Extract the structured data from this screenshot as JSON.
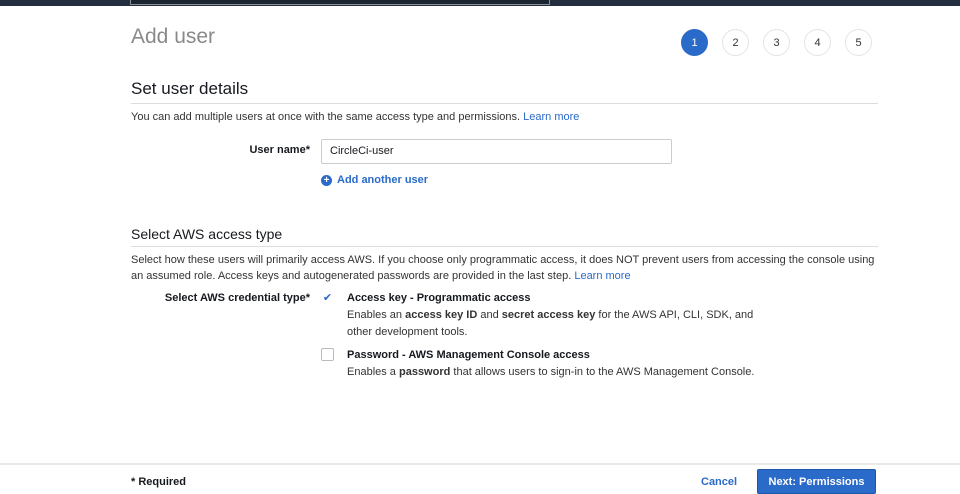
{
  "header": {
    "title": "Add user",
    "steps": [
      "1",
      "2",
      "3",
      "4",
      "5"
    ],
    "active_step": 1
  },
  "details": {
    "heading": "Set user details",
    "description": "You can add multiple users at once with the same access type and permissions.",
    "learn_more": "Learn more",
    "user_name_label": "User name*",
    "user_name_value": "CircleCi-user",
    "add_another": "Add another user"
  },
  "access": {
    "heading": "Select AWS access type",
    "description": "Select how these users will primarily access AWS. If you choose only programmatic access, it does NOT prevent users from accessing the console using an assumed role. Access keys and autogenerated passwords are provided in the last step.",
    "learn_more": "Learn more",
    "credential_label": "Select AWS credential type*",
    "options": [
      {
        "title": "Access key - Programmatic access",
        "checked": true,
        "d1": "Enables an ",
        "b1": "access key ID",
        "d2": " and ",
        "b2": "secret access key",
        "d3": " for the AWS API, CLI, SDK, and other development tools."
      },
      {
        "title": "Password - AWS Management Console access",
        "checked": false,
        "d1": "Enables a ",
        "b1": "password",
        "d2": " that allows users to sign-in to the AWS Management Console."
      }
    ]
  },
  "footer": {
    "required": "* Required",
    "cancel": "Cancel",
    "next": "Next: Permissions"
  }
}
